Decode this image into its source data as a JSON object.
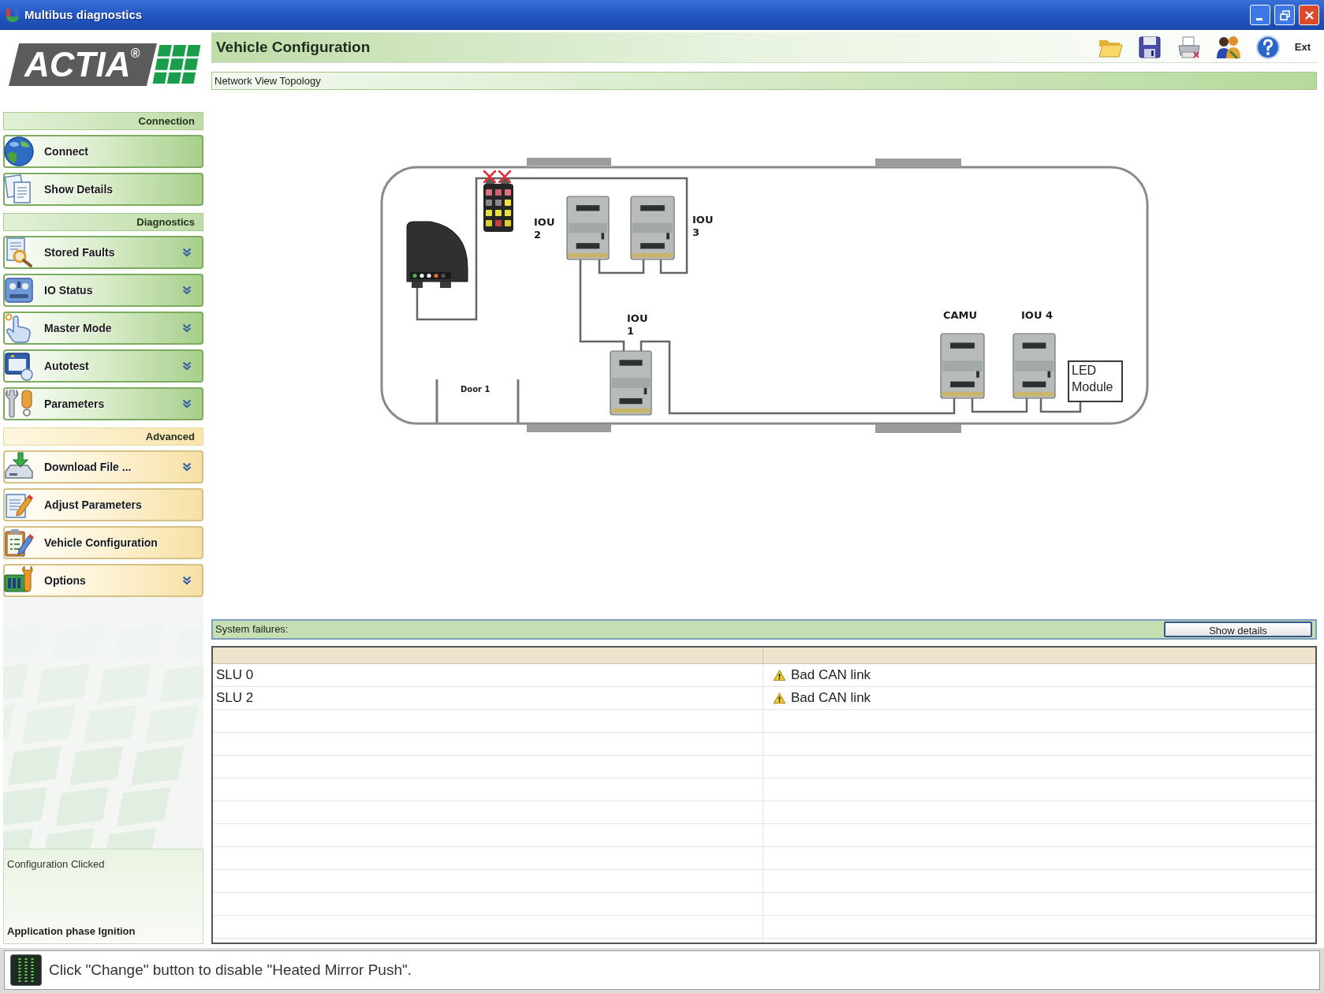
{
  "window": {
    "title": "Multibus diagnostics"
  },
  "logo": {
    "text": "ACTIA$^{®}$"
  },
  "sidebar": {
    "sections": [
      {
        "title": "Connection",
        "kind": "basic",
        "items": [
          {
            "label": "Connect",
            "has_submenu": false
          },
          {
            "label": "Show Details",
            "has_submenu": false
          }
        ]
      },
      {
        "title": "Diagnostics",
        "kind": "basic",
        "items": [
          {
            "label": "Stored Faults",
            "has_submenu": true
          },
          {
            "label": "IO Status",
            "has_submenu": true
          },
          {
            "label": "Master Mode",
            "has_submenu": true
          },
          {
            "label": "Autotest",
            "has_submenu": true
          },
          {
            "label": "Parameters",
            "has_submenu": true
          }
        ]
      },
      {
        "title": "Advanced",
        "kind": "advanced",
        "items": [
          {
            "label": "Download File ...",
            "has_submenu": true
          },
          {
            "label": "Adjust Parameters",
            "has_submenu": false
          },
          {
            "label": "Vehicle Configuration",
            "has_submenu": false
          },
          {
            "label": "Options",
            "has_submenu": true
          }
        ]
      }
    ],
    "status_panel": {
      "message": "Configuration Clicked",
      "phase": "Application phase Ignition"
    }
  },
  "header": {
    "title": "Vehicle Configuration",
    "exit_label": "Ext"
  },
  "topology": {
    "title": "Network View Topology",
    "bus_ports": [
      {
        "fault": true
      },
      {
        "fault": true
      }
    ],
    "nodes": [
      {
        "label": "IOU 2"
      },
      {
        "label": "IOU 3"
      },
      {
        "label": "IOU 1"
      },
      {
        "label": "CAMU"
      },
      {
        "label": "IOU 4"
      }
    ],
    "door_label": "Door 1",
    "led_module": "LED Module"
  },
  "failures": {
    "title": "System failures:",
    "show_details": "Show details",
    "rows": [
      {
        "column_1": "SLU 0",
        "column_2": "Bad CAN link",
        "kind": "warning"
      },
      {
        "column_1": "SLU 2",
        "column_2": "Bad CAN link",
        "kind": "warning"
      }
    ]
  },
  "status_bar": {
    "message": "Click \"Change\" button to disable \"Heated Mirror Push\"."
  }
}
